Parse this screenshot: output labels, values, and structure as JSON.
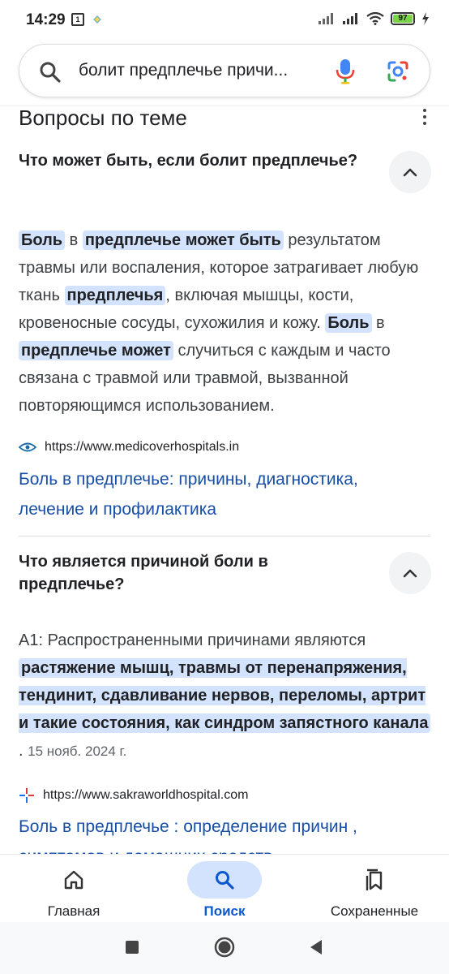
{
  "status_bar": {
    "time": "14:29",
    "notif_badge": "1",
    "battery_level": "97",
    "battery_color": "#7bd34a"
  },
  "search": {
    "query": "болит предплечье причи..."
  },
  "section": {
    "title": "Вопросы по теме"
  },
  "questions": [
    {
      "question": "Что может быть, если болит предплечье?",
      "answer_segments": [
        {
          "text": "Боль",
          "hl": true
        },
        {
          "text": " в ",
          "hl": false
        },
        {
          "text": "предплечье может быть",
          "hl": true
        },
        {
          "text": " результатом травмы или воспаления, которое затрагивает любую ткань ",
          "hl": false
        },
        {
          "text": "предплечья",
          "hl": true
        },
        {
          "text": ", включая мышцы, кости, кровеносные сосуды, сухожилия и кожу. ",
          "hl": false
        },
        {
          "text": "Боль",
          "hl": true
        },
        {
          "text": " в ",
          "hl": false
        },
        {
          "text": "предплечье может",
          "hl": true
        },
        {
          "text": " случиться с каждым и часто связана с травмой или травмой, вызванной повторяющимся использованием.",
          "hl": false
        }
      ],
      "source_url": "https://www.medicoverhospitals.in",
      "link_title": "Боль в предплечье: причины, диагностика, лечение и профилактика"
    },
    {
      "question": "Что является причиной боли в предплечье?",
      "answer_segments": [
        {
          "text": "A1: Распространенными причинами являются ",
          "hl": false
        },
        {
          "text": "растяжение мышц, травмы от перенапряжения, тендинит, сдавливание нервов, переломы, артрит и такие состояния, как синдром запястного канала",
          "hl": true
        },
        {
          "text": " . ",
          "hl": false
        }
      ],
      "date": "15 нояб. 2024 г.",
      "source_url": "https://www.sakraworldhospital.com",
      "link_title": "Боль в предплечье : определение причин , симптомов и домашних средств"
    }
  ],
  "bottom_nav": {
    "home": "Главная",
    "search": "Поиск",
    "saved": "Сохраненные"
  },
  "colors": {
    "highlight": "#d3e3fd",
    "link": "#174ea6",
    "active_nav": "#0b57d0"
  }
}
